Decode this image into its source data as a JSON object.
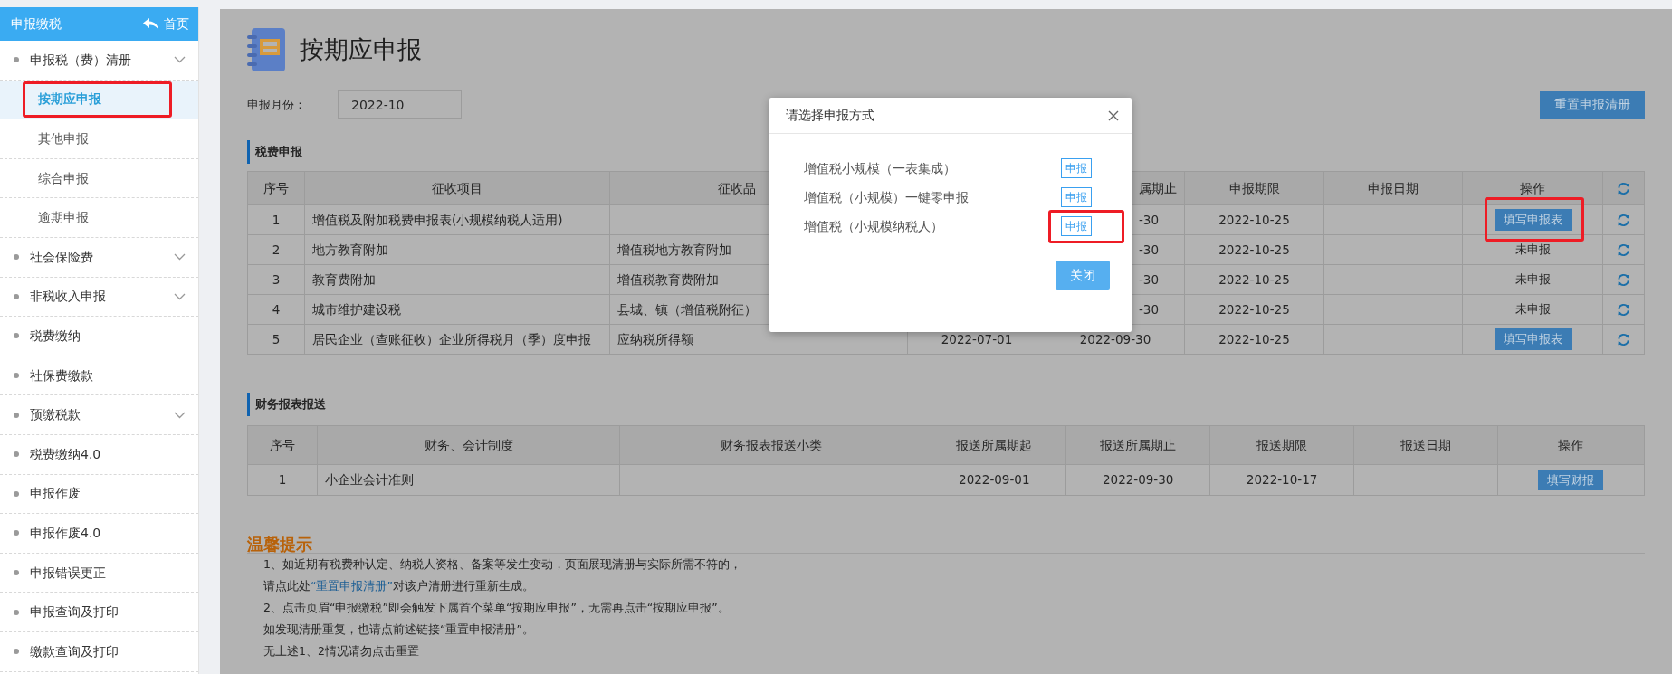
{
  "sidebar": {
    "title": "申报缴税",
    "home_link": "首页",
    "items": [
      {
        "label": "申报税（费）清册",
        "kind": "group",
        "children": [
          {
            "label": "按期应申报",
            "selected": true,
            "highlighted": true
          },
          {
            "label": "其他申报",
            "selected": false,
            "highlighted": false
          },
          {
            "label": "综合申报",
            "selected": false,
            "highlighted": false
          },
          {
            "label": "逾期申报",
            "selected": false,
            "highlighted": false
          }
        ]
      },
      {
        "label": "社会保险费",
        "kind": "group"
      },
      {
        "label": "非税收入申报",
        "kind": "group"
      },
      {
        "label": "税费缴纳",
        "kind": "link"
      },
      {
        "label": "社保费缴款",
        "kind": "link"
      },
      {
        "label": "预缴税款",
        "kind": "group"
      },
      {
        "label": "税费缴纳4.0",
        "kind": "link"
      },
      {
        "label": "申报作废",
        "kind": "link"
      },
      {
        "label": "申报作废4.0",
        "kind": "link"
      },
      {
        "label": "申报错误更正",
        "kind": "link"
      },
      {
        "label": "申报查询及打印",
        "kind": "link"
      },
      {
        "label": "缴款查询及打印",
        "kind": "link"
      }
    ]
  },
  "page": {
    "title": "按期应申报",
    "month_label": "申报月份：",
    "month_value": "2022-10",
    "reset_button": "重置申报清册"
  },
  "tax_section": {
    "title": "税费申报",
    "columns": [
      "序号",
      "征收项目",
      "征收品",
      null,
      "属期止",
      "申报期限",
      "申报日期",
      "操作"
    ],
    "rows": [
      {
        "cells": [
          "1",
          "增值税及附加税费申报表(小规模纳税人适用)",
          null,
          null,
          "-30",
          "2022-10-25",
          null
        ],
        "action": {
          "kind": "button",
          "label": "填写申报表",
          "highlighted": true
        }
      },
      {
        "cells": [
          "2",
          "地方教育附加",
          "增值税地方教育附加",
          null,
          "-30",
          "2022-10-25",
          null
        ],
        "action": {
          "kind": "status",
          "label": "未申报",
          "highlighted": false
        }
      },
      {
        "cells": [
          "3",
          "教育费附加",
          "增值税教育费附加",
          null,
          "-30",
          "2022-10-25",
          null
        ],
        "action": {
          "kind": "status",
          "label": "未申报",
          "highlighted": false
        }
      },
      {
        "cells": [
          "4",
          "城市维护建设税",
          "县城、镇（增值税附征）",
          null,
          "-30",
          "2022-10-25",
          null
        ],
        "action": {
          "kind": "status",
          "label": "未申报",
          "highlighted": false
        }
      },
      {
        "cells": [
          "5",
          "居民企业（查账征收）企业所得税月（季）度申报",
          "应纳税所得额",
          "2022-07-01",
          "2022-09-30",
          "2022-10-25",
          null
        ],
        "action": {
          "kind": "button",
          "label": "填写申报表",
          "highlighted": false
        }
      }
    ]
  },
  "finance_section": {
    "title": "财务报表报送",
    "columns": [
      "序号",
      "财务、会计制度",
      "财务报表报送小类",
      "报送所属期起",
      "报送所属期止",
      "报送期限",
      "报送日期",
      "操作"
    ],
    "rows": [
      {
        "cells": [
          "1",
          "小企业会计准则",
          null,
          "2022-09-01",
          "2022-09-30",
          "2022-10-17",
          null
        ],
        "action": {
          "kind": "button",
          "label": "填写财报",
          "highlighted": false
        }
      }
    ]
  },
  "tips": {
    "title": "温馨提示",
    "lines": [
      {
        "kind": "text",
        "text": "1、如近期有税费种认定、纳税人资格、备案等发生变动，页面展现清册与实际所需不符的，"
      },
      {
        "kind": "link",
        "before": "请点此处",
        "link": "“重置申报清册”",
        "after": "对该户清册进行重新生成。"
      },
      {
        "kind": "text",
        "text": "2、点击页眉“申报缴税”即会触发下属首个菜单“按期应申报”，无需再点击“按期应申报”。"
      },
      {
        "kind": "text",
        "text": "如发现清册重复，也请点前述链接“重置申报清册”。"
      },
      {
        "kind": "text",
        "text": "无上述1、2情况请勿点击重置"
      }
    ]
  },
  "modal": {
    "title": "请选择申报方式",
    "options": [
      {
        "label": "增值税小规模（一表集成）",
        "button": "申报",
        "highlighted": false
      },
      {
        "label": "增值税（小规模）一键零申报",
        "button": "申报",
        "highlighted": false
      },
      {
        "label": "增值税（小规模纳税人）",
        "button": "申报",
        "highlighted": true
      }
    ],
    "close_button": "关闭"
  }
}
